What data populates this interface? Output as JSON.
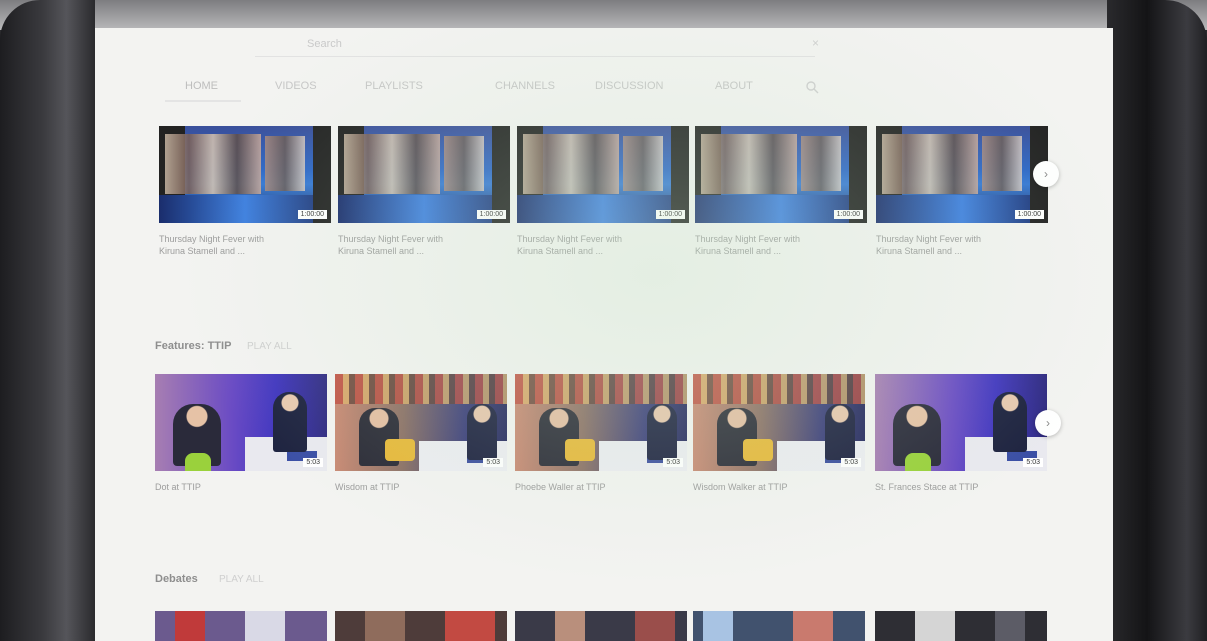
{
  "search": {
    "placeholder": "Search"
  },
  "tabs": [
    {
      "label": "HOME"
    },
    {
      "label": "VIDEOS"
    },
    {
      "label": "PLAYLISTS"
    },
    {
      "label": "CHANNELS"
    },
    {
      "label": "DISCUSSION"
    },
    {
      "label": "ABOUT"
    }
  ],
  "rows": [
    {
      "title": "",
      "subtitle": "",
      "cards": [
        {
          "title_line1": "Thursday Night Fever with",
          "title_line2": "Kiruna Stamell and ...",
          "meta1": "",
          "meta2": "",
          "duration": "1:00:00"
        },
        {
          "title_line1": "Thursday Night Fever with",
          "title_line2": "Kiruna Stamell and ...",
          "meta1": "",
          "meta2": "",
          "duration": "1:00:00"
        },
        {
          "title_line1": "Thursday Night Fever with",
          "title_line2": "Kiruna Stamell and ...",
          "meta1": "",
          "meta2": "",
          "duration": "1:00:00"
        },
        {
          "title_line1": "Thursday Night Fever with",
          "title_line2": "Kiruna Stamell and ...",
          "meta1": "",
          "meta2": "",
          "duration": "1:00:00"
        },
        {
          "title_line1": "Thursday Night Fever with",
          "title_line2": "Kiruna Stamell and ...",
          "meta1": "",
          "meta2": "",
          "duration": "1:00:00"
        }
      ]
    },
    {
      "title": "Features: TTIP",
      "subtitle": "PLAY ALL",
      "cards": [
        {
          "title_line1": "Dot at TTIP",
          "title_line2": "",
          "meta1": "",
          "meta2": "",
          "duration": "5:03"
        },
        {
          "title_line1": "Wisdom at TTIP",
          "title_line2": "",
          "meta1": "",
          "meta2": "",
          "duration": "5:03"
        },
        {
          "title_line1": "Phoebe Waller at TTIP",
          "title_line2": "",
          "meta1": "",
          "meta2": "",
          "duration": "5:03"
        },
        {
          "title_line1": "Wisdom Walker at TTIP",
          "title_line2": "",
          "meta1": "",
          "meta2": "",
          "duration": "5:03"
        },
        {
          "title_line1": "St. Frances Stace at TTIP",
          "title_line2": "",
          "meta1": "",
          "meta2": "",
          "duration": "5:03"
        }
      ]
    },
    {
      "title": "Debates",
      "subtitle": "PLAY ALL",
      "cards": [
        {},
        {},
        {},
        {},
        {}
      ]
    }
  ],
  "icons": {
    "search": "search-icon",
    "clear": "close-icon",
    "next": "chevron-right-icon"
  }
}
